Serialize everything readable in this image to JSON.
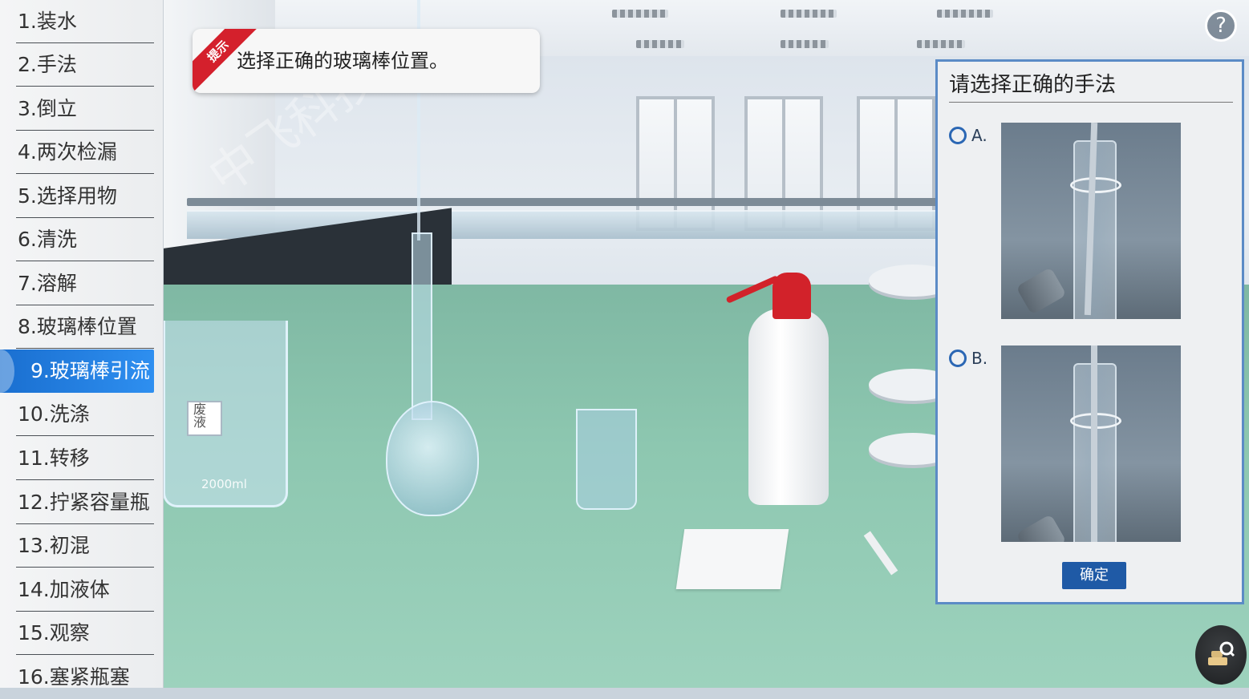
{
  "sidebar": {
    "steps": [
      {
        "label": "1.装水"
      },
      {
        "label": "2.手法"
      },
      {
        "label": "3.倒立"
      },
      {
        "label": "4.两次检漏"
      },
      {
        "label": "5.选择用物"
      },
      {
        "label": "6.清洗"
      },
      {
        "label": "7.溶解"
      },
      {
        "label": "8.玻璃棒位置"
      },
      {
        "label": "9.玻璃棒引流"
      },
      {
        "label": "10.洗涤"
      },
      {
        "label": "11.转移"
      },
      {
        "label": "12.拧紧容量瓶"
      },
      {
        "label": "13.初混"
      },
      {
        "label": "14.加液体"
      },
      {
        "label": "15.观察"
      },
      {
        "label": "16.塞紧瓶塞"
      }
    ],
    "active_index": 8
  },
  "hint": {
    "badge": "提示",
    "text": "选择正确的玻璃棒位置。"
  },
  "scene": {
    "beaker_mark": "2000ml",
    "label_text": "废液",
    "watermark": "中飞科技"
  },
  "help": {
    "icon": "question-icon",
    "symbol": "?"
  },
  "panel": {
    "title": "请选择正确的手法",
    "options": [
      {
        "label": "A."
      },
      {
        "label": "B."
      }
    ],
    "confirm_label": "确定"
  },
  "tool": {
    "icon": "search-map-icon"
  },
  "colors": {
    "accent": "#2b67b4",
    "active_step": "#1a6fd0",
    "hint_ribbon": "#d4202c",
    "confirm": "#1f5aa6"
  }
}
